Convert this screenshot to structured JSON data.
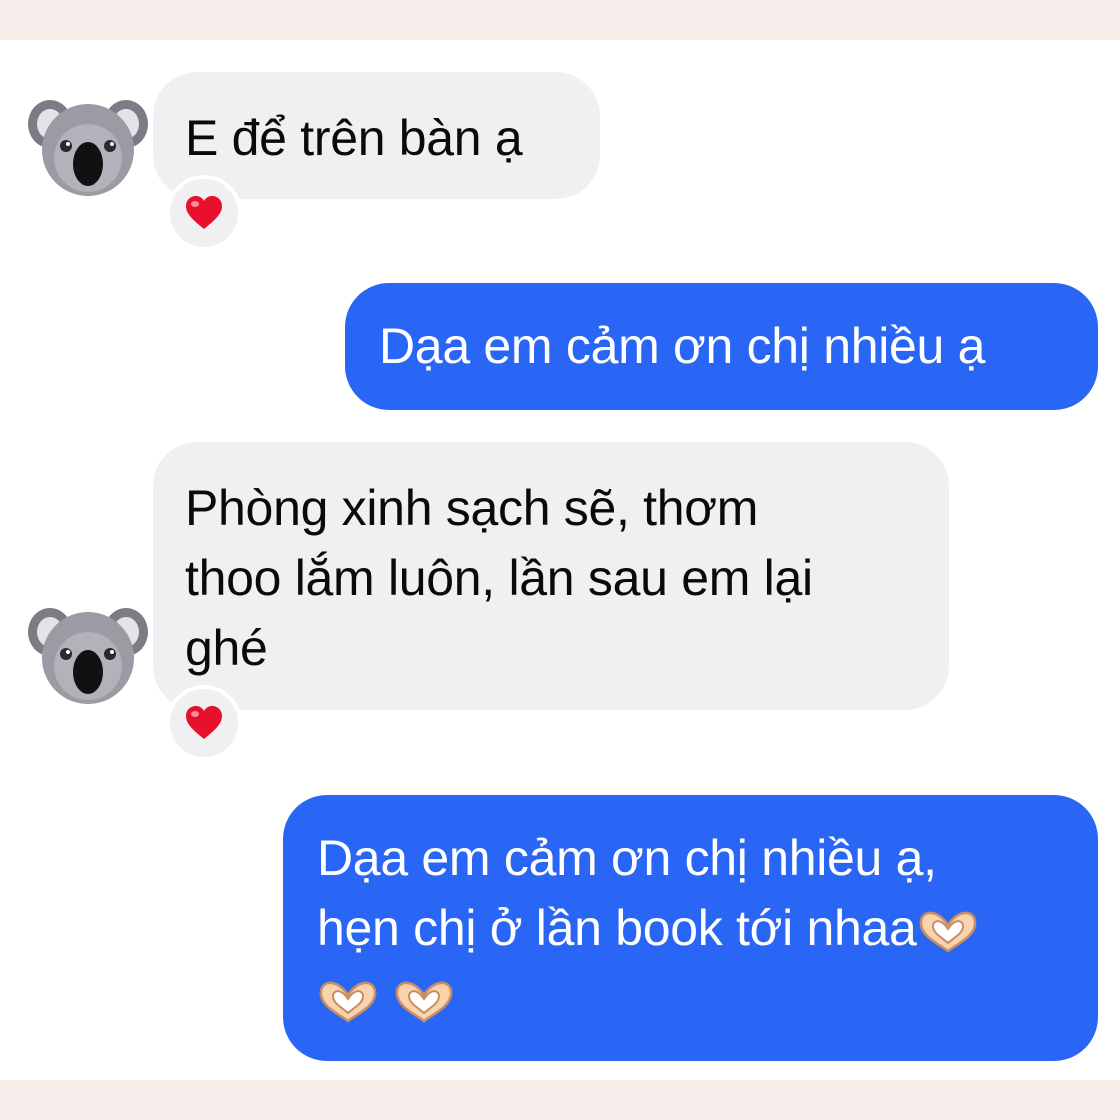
{
  "conversation": {
    "messages": [
      {
        "direction": "incoming",
        "text": "E để trên bàn ạ",
        "reaction": "red-heart"
      },
      {
        "direction": "outgoing",
        "text": "Dạa em cảm ơn chị nhiều ạ"
      },
      {
        "direction": "incoming",
        "lines": [
          "Phòng xinh sạch sẽ, thơm",
          "thoo lắm luôn, lần sau em lại",
          "ghé"
        ],
        "reaction": "red-heart"
      },
      {
        "direction": "outgoing",
        "lines": [
          "Dạa em cảm ơn chị nhiều ạ,",
          "hẹn chị ở lần book tới nhaa"
        ],
        "trailing_emoji": [
          "heart-hands",
          "heart-hands",
          "heart-hands"
        ]
      }
    ]
  },
  "colors": {
    "outgoing_bubble": "#2a66f5",
    "incoming_bubble": "#f0f0f3",
    "reaction_heart": "#e8112d",
    "page_border": "#f6eeea"
  },
  "icons": {
    "avatar": "koala-emoji",
    "reaction": "red-heart-emoji",
    "trailing": "heart-hands-emoji"
  }
}
